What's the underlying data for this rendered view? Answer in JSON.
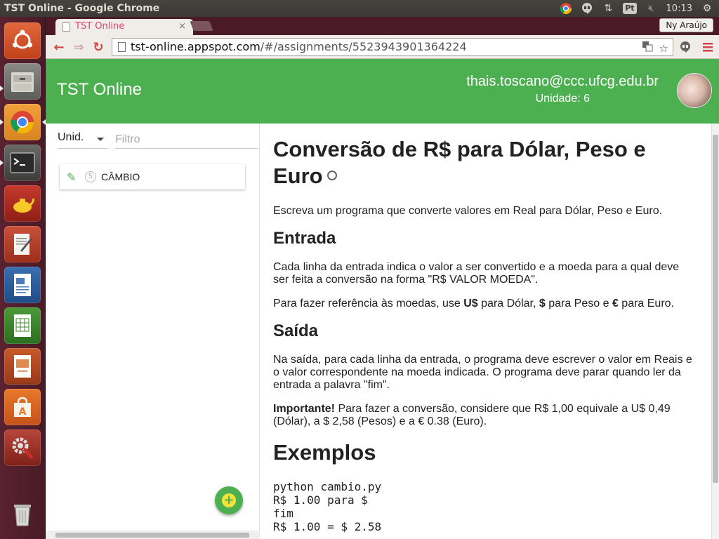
{
  "os": {
    "window_title": "TST Online - Google Chrome",
    "clock": "10:13",
    "keyboard_layout": "Pt"
  },
  "launcher": {
    "items": [
      "ubuntu-dash",
      "files",
      "chrome",
      "terminal",
      "genie",
      "text-editor",
      "writer",
      "calc",
      "impress",
      "software-center",
      "settings",
      "trash"
    ]
  },
  "browser": {
    "tab_title": "TST Online",
    "tab_close": "×",
    "profile_name": "Ny Araújo",
    "url_host": "tst-online.appspot.com",
    "url_path": "/#/assignments/5523943901364224"
  },
  "app": {
    "title": "TST Online",
    "user_email": "thais.toscano@ccc.ufcg.edu.br",
    "user_unit": "Unidade: 6",
    "accent": "#4caf50"
  },
  "sidebar": {
    "unit_select": "Unid.",
    "filter_placeholder": "Filtro",
    "assignments": [
      {
        "number": "5",
        "name": "CÂMBIO"
      }
    ],
    "fab_label": "+"
  },
  "assignment": {
    "title": "Conversão de R$ para Dólar, Peso e Euro",
    "intro": "Escreva um programa que converte valores em Real para Dólar, Peso e Euro.",
    "input_heading": "Entrada",
    "input_p1": "Cada linha da entrada indica o valor a ser convertido e a moeda para a qual deve ser feita a conversão na forma \"R$ VALOR MOEDA\".",
    "input_p2_a": "Para fazer referência às moedas, use ",
    "input_p2_b": "U$",
    "input_p2_c": " para Dólar, ",
    "input_p2_d": "$",
    "input_p2_e": " para Peso e ",
    "input_p2_f": "€",
    "input_p2_g": " para Euro.",
    "output_heading": "Saída",
    "output_p1": "Na saída, para cada linha da entrada, o programa deve escrever o valor em Reais e o valor correspondente na moeda indicada. O programa deve parar quando ler da entrada a palavra \"fim\".",
    "important_label": "Importante!",
    "important_text": " Para fazer a conversão, considere que R$ 1,00 equivale a U$ 0,49 (Dólar), a $ 2,58 (Pesos) e a € 0.38 (Euro).",
    "examples_heading": "Exemplos",
    "example_lines": [
      "python cambio.py",
      "R$ 1.00 para $",
      "fim",
      "R$ 1.00 = $ 2.58"
    ]
  }
}
